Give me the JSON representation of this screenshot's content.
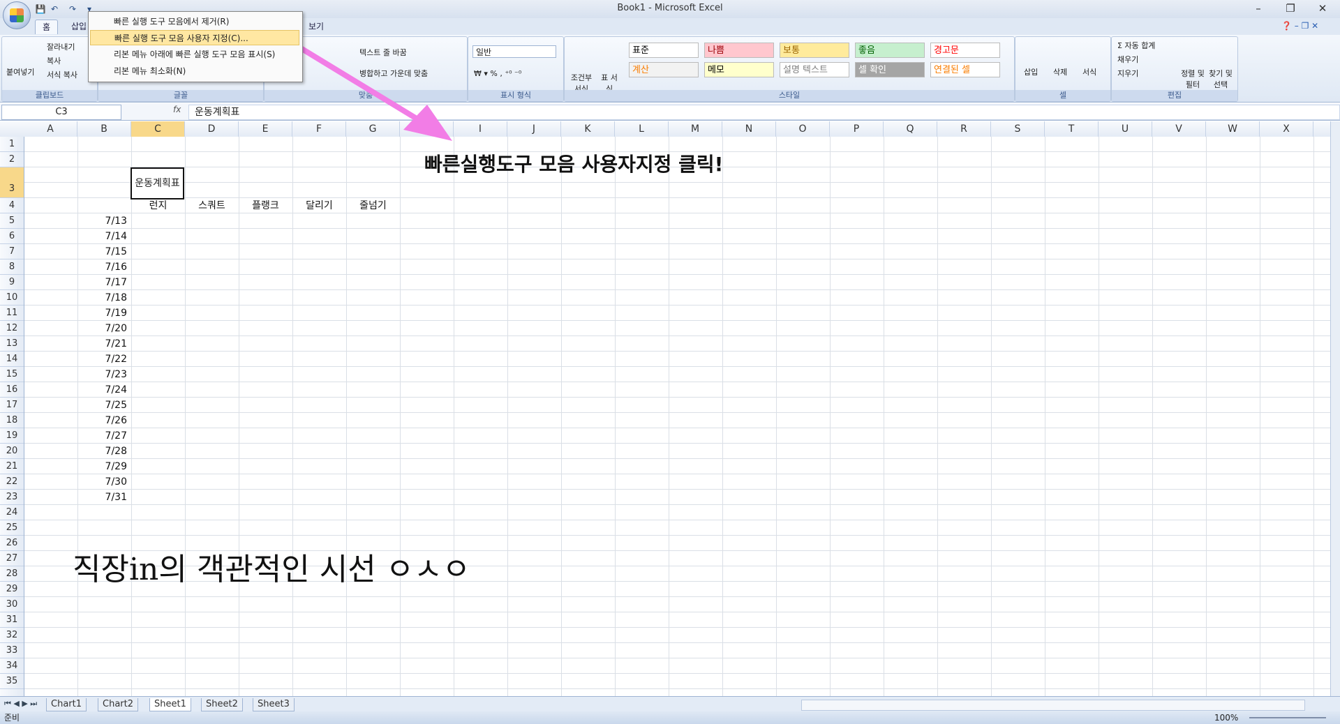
{
  "window": {
    "title": "Book1 - Microsoft Excel"
  },
  "tabs": [
    {
      "label": "홈"
    },
    {
      "label": "삽입"
    },
    {
      "label": "보기"
    }
  ],
  "context_menu": {
    "items": [
      {
        "label": "빠른 실행 도구 모음에서 제거(R)"
      },
      {
        "label": "빠른 실행 도구 모음 사용자 지정(C)..."
      },
      {
        "label": "리본 메뉴 아래에 빠른 실행 도구 모음 표시(S)"
      },
      {
        "label": "리본 메뉴 최소화(N)"
      }
    ]
  },
  "ribbon": {
    "clipboard": {
      "label": "클립보드",
      "paste": "붙여넣기",
      "cut": "잘라내기",
      "copy": "복사",
      "format_painter": "서식 복사"
    },
    "font": {
      "label": "글꼴"
    },
    "alignment": {
      "label": "맞춤",
      "wrap": "텍스트 줄 바꿈",
      "merge": "병합하고 가운데 맞춤"
    },
    "number": {
      "label": "표시 형식",
      "format": "일반"
    },
    "styles": {
      "label": "스타일",
      "conditional": "조건부 서식",
      "table": "표 서식",
      "cells": [
        {
          "name": "표준",
          "color": "#ffffff",
          "text": "#000000"
        },
        {
          "name": "나쁨",
          "color": "#ffc7ce",
          "text": "#9c0006"
        },
        {
          "name": "보통",
          "color": "#ffeb9c",
          "text": "#9c6500"
        },
        {
          "name": "좋음",
          "color": "#c6efce",
          "text": "#006100"
        },
        {
          "name": "경고문",
          "color": "#ffffff",
          "text": "#ff0000"
        },
        {
          "name": "계산",
          "color": "#f2f2f2",
          "text": "#fa7d00"
        },
        {
          "name": "메모",
          "color": "#ffffcc",
          "text": "#000000"
        },
        {
          "name": "설명 텍스트",
          "color": "#ffffff",
          "text": "#7f7f7f"
        },
        {
          "name": "셀 확인",
          "color": "#a5a5a5",
          "text": "#ffffff"
        },
        {
          "name": "연결된 셀",
          "color": "#ffffff",
          "text": "#fa7d00"
        }
      ]
    },
    "cells": {
      "label": "셀",
      "insert": "삽입",
      "delete": "삭제",
      "format": "서식"
    },
    "editing": {
      "label": "편집",
      "autosum": "자동 합계",
      "fill": "채우기",
      "clear": "지우기",
      "sort": "정렬 및 필터",
      "find": "찾기 및 선택"
    }
  },
  "formula_bar": {
    "name_box": "C3",
    "fx": "fx",
    "value": "운동계획표"
  },
  "columns": [
    "A",
    "B",
    "C",
    "D",
    "E",
    "F",
    "G",
    "H",
    "I",
    "J",
    "K",
    "L",
    "M",
    "N",
    "O",
    "P",
    "Q",
    "R",
    "S",
    "T",
    "U",
    "V",
    "W",
    "X"
  ],
  "rows": [
    "1",
    "2",
    "3",
    "4",
    "5",
    "6",
    "7",
    "8",
    "9",
    "10",
    "11",
    "12",
    "13",
    "14",
    "15",
    "16",
    "17",
    "18",
    "19",
    "20",
    "21",
    "22",
    "23",
    "24",
    "25",
    "26",
    "27",
    "28",
    "29",
    "30",
    "31",
    "32",
    "33",
    "34",
    "35"
  ],
  "sheet": {
    "title_cell": "운동계획표",
    "headers": [
      "런지",
      "스쿼트",
      "플랭크",
      "달리기",
      "줄넘기"
    ],
    "dates": [
      "7/13",
      "7/14",
      "7/15",
      "7/16",
      "7/17",
      "7/18",
      "7/19",
      "7/20",
      "7/21",
      "7/22",
      "7/23",
      "7/24",
      "7/25",
      "7/26",
      "7/27",
      "7/28",
      "7/29",
      "7/30",
      "7/31"
    ]
  },
  "annotation": {
    "text": "빠른실행도구 모음 사용자지정 클릭!",
    "arrow_color": "#f27de6"
  },
  "handwriting": "직장in의 객관적인 시선 ㅇㅅㅇ",
  "sheet_tabs": [
    "Chart1",
    "Chart2",
    "Sheet1",
    "Sheet2",
    "Sheet3"
  ],
  "status": {
    "mode": "준비",
    "zoom": "100%"
  }
}
